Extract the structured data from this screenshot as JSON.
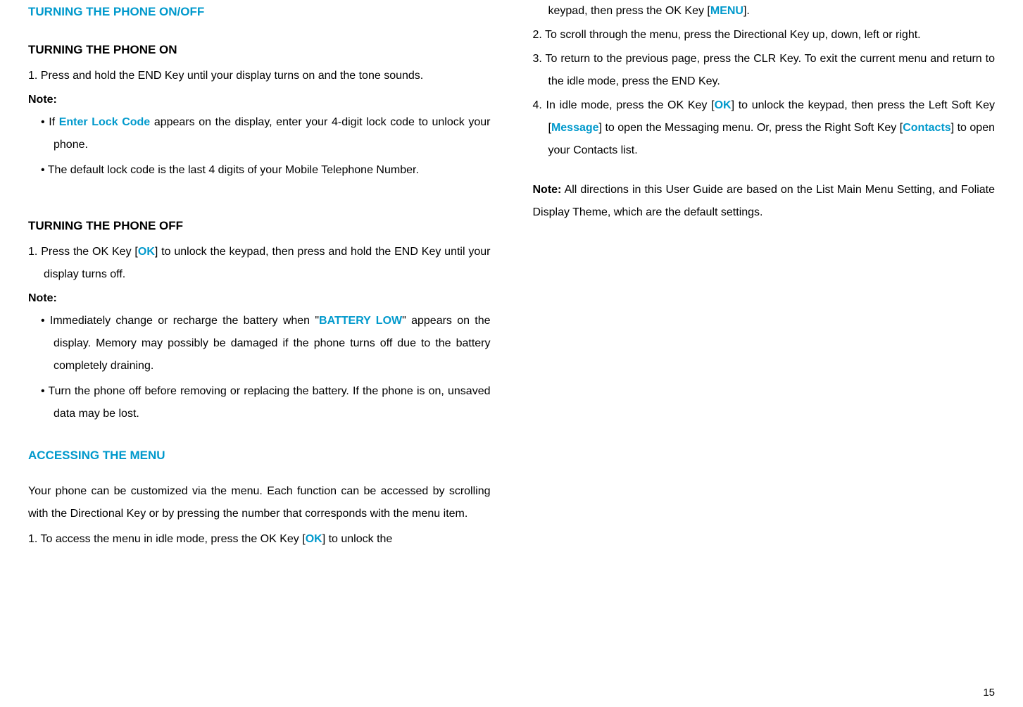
{
  "col1": {
    "h1": "TURNING THE PHONE ON/OFF",
    "h2a": "TURNING THE PHONE ON",
    "on_step1": "1.  Press and hold the END Key until your display turns on and the tone sounds.",
    "note_label": "Note:",
    "on_bullet1_a": "If ",
    "on_bullet1_b": "Enter Lock Code",
    "on_bullet1_c": " appears on the display, enter your 4-digit lock code to unlock your phone.",
    "on_bullet2": "The default lock code is the last 4 digits of your Mobile Telephone Number.",
    "h2b": "TURNING THE PHONE OFF",
    "off_step1_a": "1.  Press the OK Key [",
    "off_step1_b": "OK",
    "off_step1_c": "] to unlock the keypad, then press and hold the END Key until your display turns off.",
    "off_bullet1_a": "Immediately change or recharge the battery when \"",
    "off_bullet1_b": "BATTERY LOW",
    "off_bullet1_c": "\" appears on the display. Memory may possibly be damaged if the phone turns off due to the battery completely draining.",
    "off_bullet2": "Turn the phone off before removing or replacing the battery. If the phone is on, unsaved data may be lost.",
    "h1b": "ACCESSING THE MENU",
    "menu_intro": "Your phone can be customized via the menu. Each function can be accessed by scrolling with the Directional Key or by pressing the number that corresponds with the menu item.",
    "menu_step1_a": "1.  To access the menu in idle mode, press the OK Key [",
    "menu_step1_b": "OK",
    "menu_step1_c": "] to unlock the"
  },
  "col2": {
    "cont_a": "keypad, then press the OK Key [",
    "cont_b": "MENU",
    "cont_c": "].",
    "step2": "2.  To scroll through the menu, press the Directional Key up, down, left or right.",
    "step3": "3.  To return to the previous page, press the CLR Key. To exit the current menu and return to the idle mode, press the END Key.",
    "step4_a": "4.  In idle mode, press the OK Key [",
    "step4_b": "OK",
    "step4_c": "] to unlock the keypad, then press the Left Soft Key [",
    "step4_d": "Message",
    "step4_e": "] to open the Messaging menu. Or, press the Right Soft Key [",
    "step4_f": "Contacts",
    "step4_g": "] to open your Contacts list.",
    "note2_label": "Note:",
    "note2_body": " All directions in this User Guide are based on the List Main Menu Setting, and Foliate Display Theme, which are the default settings."
  },
  "page_number": "15"
}
